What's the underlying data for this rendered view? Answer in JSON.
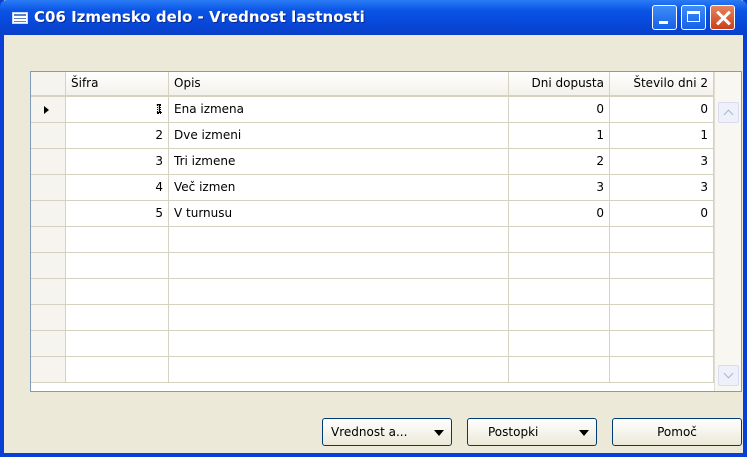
{
  "window": {
    "title": "C06 Izmensko delo - Vrednost lastnosti"
  },
  "table": {
    "headers": {
      "sifra": "Šifra",
      "opis": "Opis",
      "dni_dopusta": "Dni dopusta",
      "stevilo_dni_2": "Število dni 2"
    },
    "rows": [
      {
        "sifra": "1",
        "opis": "Ena izmena",
        "dni_dopusta": "0",
        "stevilo_dni_2": "0"
      },
      {
        "sifra": "2",
        "opis": "Dve izmeni",
        "dni_dopusta": "1",
        "stevilo_dni_2": "1"
      },
      {
        "sifra": "3",
        "opis": "Tri izmene",
        "dni_dopusta": "2",
        "stevilo_dni_2": "3"
      },
      {
        "sifra": "4",
        "opis": "Več izmen",
        "dni_dopusta": "3",
        "stevilo_dni_2": "3"
      },
      {
        "sifra": "5",
        "opis": "V turnusu",
        "dni_dopusta": "0",
        "stevilo_dni_2": "0"
      }
    ]
  },
  "buttons": {
    "vrednost": "Vrednost a...",
    "postopki": "Postopki",
    "pomoc": "Pomoč"
  },
  "colors": {
    "titlebar": "#0a54e6",
    "window_bg": "#ece9d8",
    "close": "#c8401a"
  }
}
